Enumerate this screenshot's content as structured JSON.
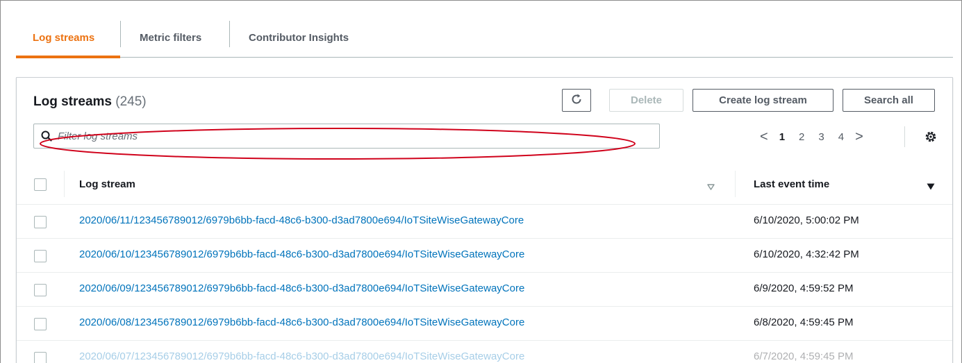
{
  "tabs": [
    {
      "label": "Log streams",
      "active": true
    },
    {
      "label": "Metric filters",
      "active": false
    },
    {
      "label": "Contributor Insights",
      "active": false
    }
  ],
  "header": {
    "title": "Log streams",
    "count": "(245)"
  },
  "actions": {
    "refresh_icon": "refresh-icon",
    "delete_label": "Delete",
    "create_label": "Create log stream",
    "search_label": "Search all"
  },
  "filter": {
    "placeholder": "Filter log streams",
    "value": ""
  },
  "pagination": {
    "prev": "<",
    "pages": [
      "1",
      "2",
      "3",
      "4"
    ],
    "current": "1",
    "next": ">"
  },
  "table": {
    "columns": [
      "Log stream",
      "Last event time"
    ],
    "rows": [
      {
        "stream": "2020/06/11/123456789012/6979b6bb-facd-48c6-b300-d3ad7800e694/IoTSiteWiseGatewayCore",
        "time": "6/10/2020, 5:00:02 PM",
        "highlighted": true
      },
      {
        "stream": "2020/06/10/123456789012/6979b6bb-facd-48c6-b300-d3ad7800e694/IoTSiteWiseGatewayCore",
        "time": "6/10/2020, 4:32:42 PM"
      },
      {
        "stream": "2020/06/09/123456789012/6979b6bb-facd-48c6-b300-d3ad7800e694/IoTSiteWiseGatewayCore",
        "time": "6/9/2020, 4:59:52 PM"
      },
      {
        "stream": "2020/06/08/123456789012/6979b6bb-facd-48c6-b300-d3ad7800e694/IoTSiteWiseGatewayCore",
        "time": "6/8/2020, 4:59:45 PM"
      },
      {
        "stream": "2020/06/07/123456789012/6979b6bb-facd-48c6-b300-d3ad7800e694/IoTSiteWiseGatewayCore",
        "time": "6/7/2020, 4:59:45 PM"
      }
    ]
  },
  "colors": {
    "accent": "#ec7211",
    "link": "#0073bb",
    "highlight_ring": "#d0021b"
  }
}
